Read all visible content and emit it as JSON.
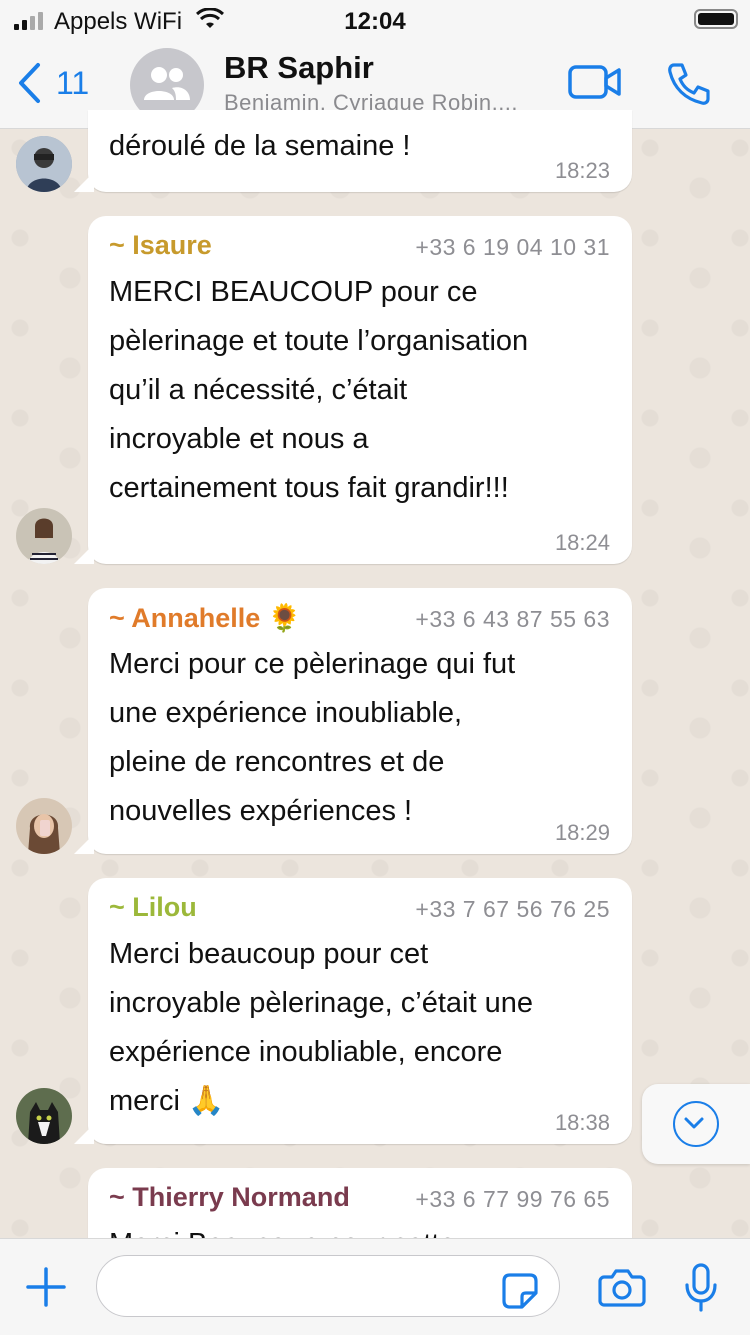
{
  "status_bar": {
    "carrier": "Appels WiFi",
    "time": "12:04"
  },
  "header": {
    "back_count": "11",
    "title": "BR Saphir",
    "subtitle": "Benjamin, Cyriaque Robin,..."
  },
  "messages": [
    {
      "sender": "",
      "phone": "",
      "text": "déroulé de la semaine !",
      "time": "18:23"
    },
    {
      "sender": "~ Isaure",
      "sender_color": "#c79a2c",
      "phone": "+33 6 19 04 10 31",
      "text": "MERCI BEAUCOUP pour ce\npèlerinage et toute l’organisation\nqu’il a nécessité, c’était\nincroyable et nous a\ncertainement tous fait grandir!!!",
      "time": "18:24"
    },
    {
      "sender": "~ Annahelle 🌻",
      "sender_color": "#e07b2a",
      "phone": "+33 6 43 87 55 63",
      "text": "Merci pour ce pèlerinage qui fut\nune expérience inoubliable,\npleine de rencontres et de\nnouvelles expériences !",
      "time": "18:29"
    },
    {
      "sender": "~ Lilou",
      "sender_color": "#9cb83a",
      "phone": "+33 7 67 56 76 25",
      "text": "Merci beaucoup pour cet\nincroyable pèlerinage, c’était une\nexpérience inoubliable, encore\nmerci 🙏",
      "time": "18:38"
    },
    {
      "sender": "~ Thierry Normand",
      "sender_color": "#7a3b4e",
      "phone": "+33 6 77 99 76 65",
      "text": "Merci Beaucoup pour cette",
      "time": ""
    }
  ],
  "colors": {
    "accent": "#1a7ee8",
    "bubble": "#ffffff",
    "wallpaper": "#ece5dd"
  }
}
